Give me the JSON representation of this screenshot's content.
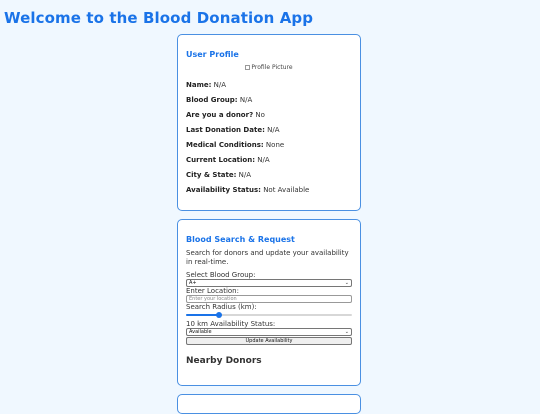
{
  "app": {
    "title": "Welcome to the Blood Donation App"
  },
  "profile": {
    "heading": "User Profile",
    "picture_alt": "Profile Picture",
    "fields": [
      {
        "label": "Name:",
        "value": "N/A"
      },
      {
        "label": "Blood Group:",
        "value": "N/A"
      },
      {
        "label": "Are you a donor?",
        "value": "No"
      },
      {
        "label": "Last Donation Date:",
        "value": "N/A"
      },
      {
        "label": "Medical Conditions:",
        "value": "None"
      },
      {
        "label": "Current Location:",
        "value": "N/A"
      },
      {
        "label": "City & State:",
        "value": "N/A"
      },
      {
        "label": "Availability Status:",
        "value": "Not Available"
      }
    ]
  },
  "search": {
    "heading": "Blood Search & Request",
    "description": "Search for donors and update your availability in real-time.",
    "blood_group_label": "Select Blood Group:",
    "blood_group_value": "A+",
    "location_label": "Enter Location:",
    "location_placeholder": "Enter your location",
    "radius_label": "Search Radius (km):",
    "radius_fraction": 0.2,
    "availability_label": "10 km Availability Status:",
    "availability_value": "Available",
    "update_button": "Update Availability",
    "nearby_heading": "Nearby Donors"
  },
  "colors": {
    "accent": "#1a73e8",
    "card_border": "#4a90e2",
    "background": "#f0f8ff"
  }
}
